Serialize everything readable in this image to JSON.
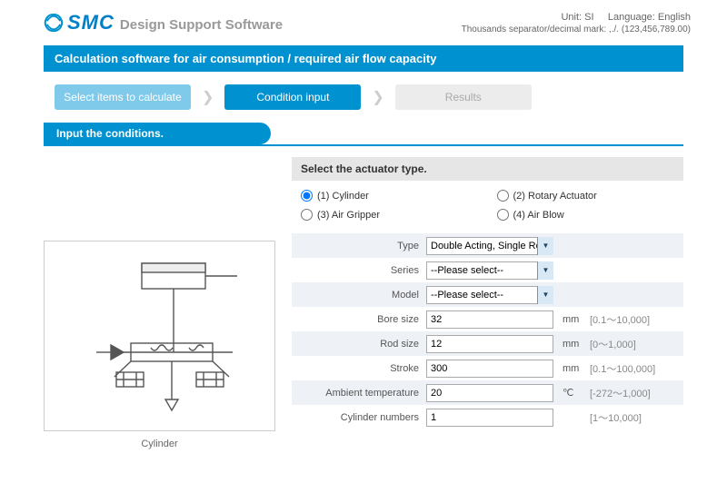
{
  "header": {
    "brand": "SMC",
    "subtitle": "Design Support Software",
    "unit_label": "Unit:",
    "unit_value": "SI",
    "lang_label": "Language:",
    "lang_value": "English",
    "separator_note": "Thousands separator/decimal mark: ,./. (123,456,789.00)"
  },
  "title_bar": "Calculation software for air consumption / required air flow capacity",
  "steps": {
    "s1": "Select items to calculate",
    "s2": "Condition input",
    "s3": "Results"
  },
  "section_tab": "Input the conditions.",
  "right": {
    "actuator_heading": "Select the actuator type.",
    "options": {
      "o1": "(1) Cylinder",
      "o2": "(2) Rotary Actuator",
      "o3": "(3) Air Gripper",
      "o4": "(4) Air Blow"
    },
    "fields": {
      "type_label": "Type",
      "type_value": "Double Acting, Single Rod",
      "series_label": "Series",
      "series_value": "--Please select--",
      "model_label": "Model",
      "model_value": "--Please select--",
      "bore_label": "Bore size",
      "bore_value": "32",
      "bore_unit": "mm",
      "bore_range": "[0.1～10,000]",
      "rod_label": "Rod size",
      "rod_value": "12",
      "rod_unit": "mm",
      "rod_range": "[0～1,000]",
      "stroke_label": "Stroke",
      "stroke_value": "300",
      "stroke_unit": "mm",
      "stroke_range": "[0.1～100,000]",
      "ambient_label": "Ambient temperature",
      "ambient_value": "20",
      "ambient_unit": "℃",
      "ambient_range": "[-272～1,000]",
      "cylnum_label": "Cylinder numbers",
      "cylnum_value": "1",
      "cylnum_unit": "",
      "cylnum_range": "[1～10,000]"
    }
  },
  "diagram_caption": "Cylinder"
}
